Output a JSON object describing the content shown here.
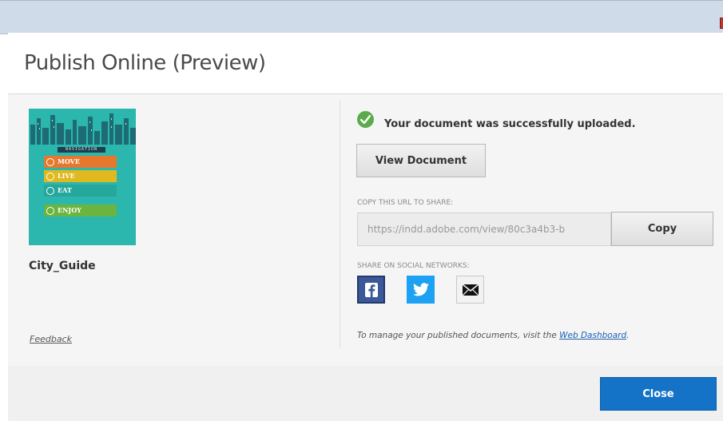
{
  "window": {
    "close_glyph": "x"
  },
  "header": {
    "title": "Publish Online (Preview)"
  },
  "document": {
    "thumbnail": {
      "nav_label": "NAVIGATION",
      "menu": [
        {
          "label": "MOVE",
          "color": "#e8772e"
        },
        {
          "label": "LIVE",
          "color": "#e0b81f"
        },
        {
          "label": "EAT",
          "color": "#26a79b"
        },
        {
          "label": "ENJOY",
          "color": "#6bb43f"
        }
      ]
    },
    "name": "City_Guide"
  },
  "feedback": {
    "label": "Feedback"
  },
  "status": {
    "message": "Your document was successfully uploaded.",
    "icon": "checkmark-circle-icon",
    "color": "#5bab4b"
  },
  "actions": {
    "view_document": "View Document",
    "copy": "Copy",
    "close": "Close"
  },
  "share": {
    "url_label": "COPY THIS URL TO SHARE:",
    "url_value": "https://indd.adobe.com/view/80c3a4b3-b",
    "social_label": "SHARE ON SOCIAL NETWORKS:",
    "networks": [
      {
        "name": "facebook-icon",
        "color": "#3b5998"
      },
      {
        "name": "twitter-icon",
        "color": "#1da1f2"
      },
      {
        "name": "email-icon",
        "color": "#f2f2f2"
      }
    ]
  },
  "manage": {
    "text": "To manage your published documents, visit the",
    "link": "Web Dashboard",
    "suffix": "."
  }
}
